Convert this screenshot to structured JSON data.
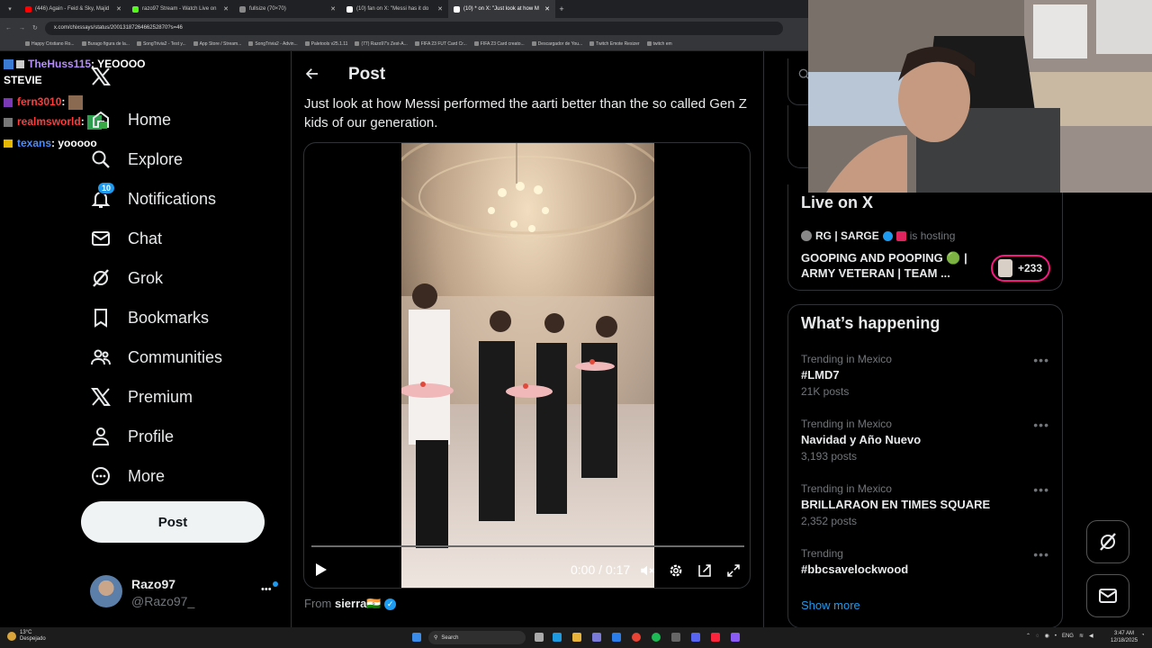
{
  "browser": {
    "tabs": [
      {
        "label": "(446) Again - Feid & Sky, Majid",
        "color": "#ff0000",
        "active": false
      },
      {
        "label": "razo97 Stream - Watch Live on",
        "color": "#53fc18",
        "active": false
      },
      {
        "label": "fullsize (70×70)",
        "color": "#888888",
        "active": false
      },
      {
        "label": "(10) fan on X: \"Messi has it do",
        "color": "#ffffff",
        "active": false
      },
      {
        "label": "(10) * on X: \"Just look at how M",
        "color": "#ffffff",
        "active": true
      }
    ],
    "new_tab": "+",
    "url": "x.com/chixssays/status/2001318726466252870?s=46",
    "bookmarks": [
      "Happy Cristiano Ro...",
      "Burago figura de la...",
      "SongTrivia2 - Test y...",
      "App Store / Stream...",
      "SongTrivia2 - Advin...",
      "Paletools v25.1.11",
      "(77) Razo97's Zest-A...",
      "FIFA 23 FUT Card Cr...",
      "FIFA 23 Card creato...",
      "Descargador de You...",
      "Twitch Emote Resizer",
      "twitch em"
    ]
  },
  "chat": {
    "lines": [
      {
        "user": "TheHuss115",
        "text": ": YEOOOO",
        "color": "#b68cff"
      },
      {
        "user": "",
        "text": "STEVIE",
        "color": "#ffffff"
      },
      {
        "user": "fern3010",
        "text": ":",
        "color": "#ff3b3b"
      },
      {
        "user": "realmsworld",
        "text": ":",
        "color": "#ff3b3b"
      },
      {
        "user": "texans",
        "text": ": yooooo",
        "color": "#4a8cff"
      }
    ]
  },
  "nav": {
    "items": [
      {
        "label": "Home",
        "icon": "home-icon"
      },
      {
        "label": "Explore",
        "icon": "search-icon"
      },
      {
        "label": "Notifications",
        "icon": "bell-icon",
        "badge": "10"
      },
      {
        "label": "Chat",
        "icon": "mail-icon"
      },
      {
        "label": "Grok",
        "icon": "grok-icon"
      },
      {
        "label": "Bookmarks",
        "icon": "bookmark-icon"
      },
      {
        "label": "Communities",
        "icon": "communities-icon"
      },
      {
        "label": "Premium",
        "icon": "x-logo-icon"
      },
      {
        "label": "Profile",
        "icon": "person-icon"
      },
      {
        "label": "More",
        "icon": "more-circle-icon"
      }
    ],
    "post_button": "Post",
    "account": {
      "name": "Razo97",
      "handle": "@Razo97_",
      "more": "•••"
    }
  },
  "post": {
    "header": "Post",
    "text": "Just look at how Messi performed the aarti better than the so called Gen Z kids of our generation.",
    "video": {
      "time": "0:00 / 0:17",
      "progress": 0.0
    },
    "from_label": "From",
    "from_user": "sierra🇮🇳"
  },
  "live": {
    "title": "Live on X",
    "host": "RG | SARGE",
    "hosting": "is hosting",
    "stream_title_1": "GOOPING AND POOPING 🟢 |",
    "stream_title_2": "ARMY VETERAN | TEAM ...",
    "listeners": "+233"
  },
  "happening": {
    "title": "What’s happening",
    "trends": [
      {
        "meta": "Trending in Mexico",
        "name": "#LMD7",
        "count": "21K posts"
      },
      {
        "meta": "Trending in Mexico",
        "name": "Navidad y Año Nuevo",
        "count": "3,193 posts"
      },
      {
        "meta": "Trending in Mexico",
        "name": "BRILLARAON EN TIMES SQUARE",
        "count": "2,352 posts"
      },
      {
        "meta": "Trending",
        "name": "#bbcsavelockwood",
        "count": ""
      }
    ],
    "show_more": "Show more"
  },
  "taskbar": {
    "weather_temp": "13°C",
    "weather_desc": "Despejado",
    "search": "Search",
    "lang": "ENG",
    "time": "3:47 AM",
    "date": "12/18/2025"
  },
  "colors": {
    "accent": "#1d9bf0",
    "border": "#2f3336",
    "muted": "#71767b"
  }
}
